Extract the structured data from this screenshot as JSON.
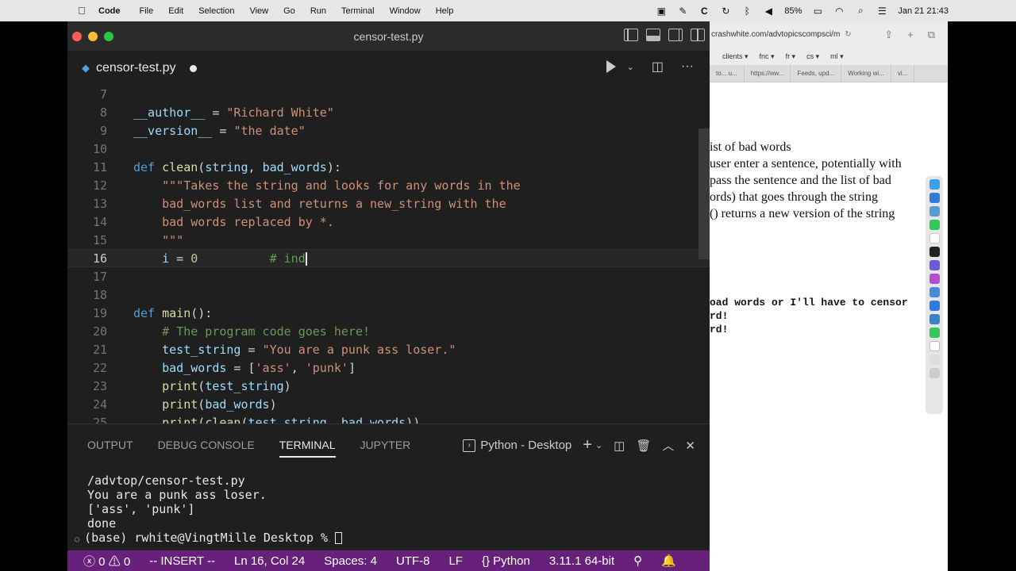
{
  "menubar": {
    "app": "Code",
    "items": [
      "File",
      "Edit",
      "Selection",
      "View",
      "Go",
      "Run",
      "Terminal",
      "Window",
      "Help"
    ],
    "battery": "85%",
    "datetime": "Jan 21  21:43"
  },
  "window": {
    "title": "censor-test.py"
  },
  "tab": {
    "label": "censor-test.py"
  },
  "editor": {
    "lines": [
      {
        "n": "7"
      },
      {
        "n": "8"
      },
      {
        "n": "9"
      },
      {
        "n": "10"
      },
      {
        "n": "11"
      },
      {
        "n": "12"
      },
      {
        "n": "13"
      },
      {
        "n": "14"
      },
      {
        "n": "15"
      },
      {
        "n": "16"
      },
      {
        "n": "17"
      },
      {
        "n": "18"
      },
      {
        "n": "19"
      },
      {
        "n": "20"
      },
      {
        "n": "21"
      },
      {
        "n": "22"
      },
      {
        "n": "23"
      },
      {
        "n": "24"
      },
      {
        "n": "25"
      }
    ],
    "code": {
      "l8_a": "__author__",
      "l8_b": " = ",
      "l8_c": "\"Richard White\"",
      "l9_a": "__version__",
      "l9_b": " = ",
      "l9_c": "\"the date\"",
      "l11_a": "def ",
      "l11_b": "clean",
      "l11_c": "(",
      "l11_d": "string",
      "l11_e": ", ",
      "l11_f": "bad_words",
      "l11_g": "):",
      "l12": "    \"\"\"Takes the string and looks for any words in the",
      "l13": "    bad_words list and returns a new_string with the",
      "l14": "    bad words replaced by *.",
      "l15": "    \"\"\"",
      "l16_a": "    ",
      "l16_b": "i",
      "l16_c": " = ",
      "l16_d": "0",
      "l16_e": "          # ind",
      "l19_a": "def ",
      "l19_b": "main",
      "l19_c": "():",
      "l20": "    # The program code goes here!",
      "l21_a": "    ",
      "l21_b": "test_string",
      "l21_c": " = ",
      "l21_d": "\"You are a punk ass loser.\"",
      "l22_a": "    ",
      "l22_b": "bad_words",
      "l22_c": " = [",
      "l22_d": "'ass'",
      "l22_e": ", ",
      "l22_f": "'punk'",
      "l22_g": "]",
      "l23_a": "    ",
      "l23_b": "print",
      "l23_c": "(",
      "l23_d": "test_string",
      "l23_e": ")",
      "l24_a": "    ",
      "l24_b": "print",
      "l24_c": "(",
      "l24_d": "bad_words",
      "l24_e": ")",
      "l25_a": "    ",
      "l25_b": "print",
      "l25_c": "(",
      "l25_d": "clean",
      "l25_e": "(",
      "l25_f": "test_string",
      "l25_g": ", ",
      "l25_h": "bad_words",
      "l25_i": "))"
    }
  },
  "panel": {
    "tabs": [
      "OUTPUT",
      "DEBUG CONSOLE",
      "TERMINAL",
      "JUPYTER"
    ],
    "terminal_name": "Python - Desktop",
    "output": [
      "/advtop/censor-test.py",
      "You are a punk ass loser.",
      "['ass', 'punk']",
      "done"
    ],
    "prompt": "(base) rwhite@VingtMille Desktop % "
  },
  "status": {
    "errors": "0",
    "warnings": "0",
    "mode": "-- INSERT --",
    "position": "Ln 16, Col 24",
    "spaces": "Spaces: 4",
    "encoding": "UTF-8",
    "eol": "LF",
    "language": "Python",
    "interpreter": "3.11.1 64-bit"
  },
  "browser": {
    "url": "crashwhite.com/advtopicscompsci/m",
    "bookmarks": [
      "clients ▾",
      "fnc ▾",
      "fr ▾",
      "cs ▾",
      "ml ▾"
    ],
    "tabs": [
      "to... u...",
      "https://ww...",
      "Feeds, upd...",
      "Working wi...",
      "vi..."
    ],
    "serif_lines": [
      "ist of bad words",
      "user enter a sentence, potentially with",
      "pass the sentence and the list of bad",
      "ords) that goes through the string",
      "() returns a new version of the string"
    ],
    "mono_lines": [
      "oad words or I'll have to censor",
      "rd!",
      "rd!"
    ]
  }
}
